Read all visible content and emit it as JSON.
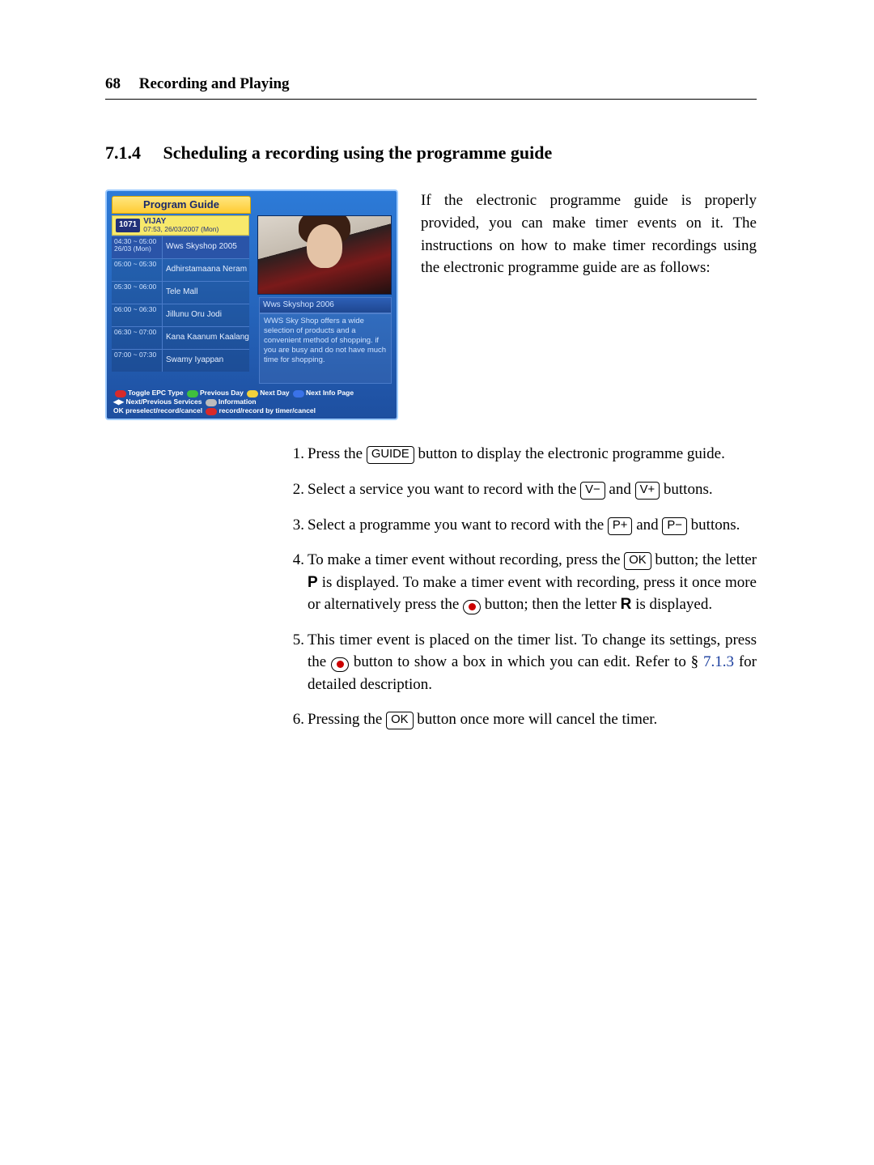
{
  "page_number": "68",
  "chapter_title": "Recording and Playing",
  "section_number": "7.1.4",
  "section_title": "Scheduling a recording using the programme guide",
  "intro": "If the electronic programme guide is properly provided, you can make timer events on it. The instructions on how to make timer recordings using the electronic programme guide are as follows:",
  "epg": {
    "title": "Program Guide",
    "channel_number": "1071",
    "channel_name": "VIJAY",
    "channel_datetime": "07:53, 26/03/2007 (Mon)",
    "rows": [
      {
        "time": "04:30 ~ 05:00\n26/03 (Mon)",
        "name": "Wws Skyshop 2005"
      },
      {
        "time": "05:00 ~ 05:30",
        "name": "Adhirstamaana Neram"
      },
      {
        "time": "05:30 ~ 06:00",
        "name": "Tele Mall"
      },
      {
        "time": "06:00 ~ 06:30",
        "name": "Jillunu Oru Jodi"
      },
      {
        "time": "06:30 ~ 07:00",
        "name": "Kana Kaanum Kaalangal"
      },
      {
        "time": "07:00 ~ 07:30",
        "name": "Swamy Iyappan"
      }
    ],
    "caption": "Wws Skyshop 2006",
    "description": "WWS Sky Shop offers a wide selection of products and a convenient method of shopping. if you are busy and do not have much time for shopping.",
    "legend": {
      "toggle": "Toggle EPC Type",
      "prevday": "Previous Day",
      "nextday": "Next Day",
      "nextinfo": "Next Info Page",
      "nextprev": "Next/Previous Services",
      "info": "Information",
      "presel": "preselect/record/cancel",
      "recby": "record/record by timer/cancel"
    }
  },
  "buttons": {
    "guide": "GUIDE",
    "vminus": "V−",
    "vplus": "V+",
    "pplus": "P+",
    "pminus": "P−",
    "ok": "OK"
  },
  "letters": {
    "p": "P",
    "r": "R"
  },
  "steps": {
    "s1a": "Press the ",
    "s1b": " button to display the electronic programme guide.",
    "s2a": "Select a service you want to record with the ",
    "s2b": " and ",
    "s2c": " buttons.",
    "s3a": "Select a programme you want to record with the ",
    "s3b": " and ",
    "s3c": " buttons.",
    "s4a": "To make a timer event without recording, press the ",
    "s4b": " button; the letter ",
    "s4c": " is displayed. To make a timer event with recording, press it once more or alternatively press the ",
    "s4d": " button; then the letter ",
    "s4e": " is displayed.",
    "s5a": "This timer event is placed on the timer list. To change its settings, press the ",
    "s5b": " button to show a box in which you can edit. Refer to § ",
    "s5ref": "7.1.3",
    "s5c": " for detailed description.",
    "s6a": "Pressing the ",
    "s6b": " button once more will cancel the timer."
  }
}
